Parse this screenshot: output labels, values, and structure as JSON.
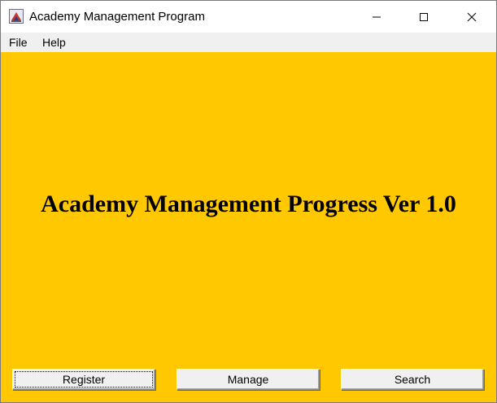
{
  "window": {
    "title": "Academy Management Program",
    "icon": "java-app-icon",
    "controls": [
      "minimize-icon",
      "maximize-icon",
      "close-icon"
    ]
  },
  "menu": {
    "items": [
      {
        "label": "File"
      },
      {
        "label": "Help"
      }
    ]
  },
  "main": {
    "headline": "Academy Management Progress Ver 1.0",
    "background_color": "#ffc800"
  },
  "buttons": {
    "register": "Register",
    "manage": "Manage",
    "search": "Search"
  }
}
